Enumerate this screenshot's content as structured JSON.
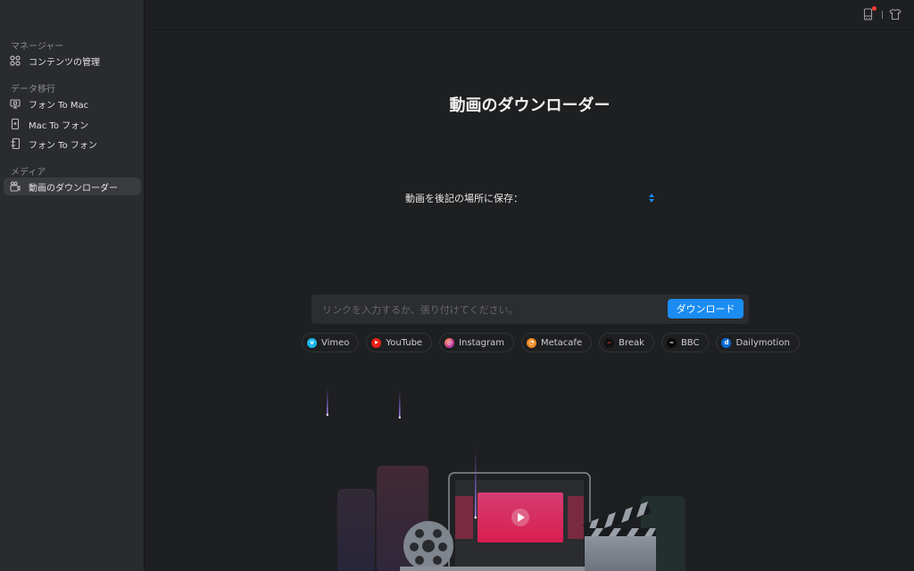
{
  "sidebar": {
    "sections": [
      {
        "label": "マネージャー",
        "items": [
          {
            "label": "コンテンツの管理",
            "icon": "grid-icon"
          }
        ]
      },
      {
        "label": "データ移行",
        "items": [
          {
            "label": "フォン To Mac",
            "icon": "monitor-icon"
          },
          {
            "label": "Mac To フォン",
            "icon": "phone-icon"
          },
          {
            "label": "フォン To フォン",
            "icon": "phone-transfer-icon"
          }
        ]
      },
      {
        "label": "メディア",
        "items": [
          {
            "label": "動画のダウンローダー",
            "icon": "video-download-icon",
            "active": true
          }
        ]
      }
    ]
  },
  "topbar": {
    "icons": [
      "device-icon",
      "tshirt-icon"
    ],
    "notification_color": "#ff3b30"
  },
  "main": {
    "title": "動画のダウンローダー",
    "save_label": "動画を後記の場所に保存：",
    "url_placeholder": "リンクを入力するか、張り付けてください。",
    "url_value": "",
    "download_label": "ダウンロード",
    "accent_color": "#1a8cf2",
    "sites": [
      {
        "name": "Vimeo",
        "color": "#1ab7ea",
        "glyph": "v"
      },
      {
        "name": "YouTube",
        "color": "#e62117",
        "glyph": "▶"
      },
      {
        "name": "Instagram",
        "color": "#d6408f",
        "glyph": "◎"
      },
      {
        "name": "Metacafe",
        "color": "#f08a24",
        "glyph": "◔"
      },
      {
        "name": "Break",
        "color": "#111111",
        "glyph": "━"
      },
      {
        "name": "BBC",
        "color": "#0a0a0a",
        "glyph": "━"
      },
      {
        "name": "Dailymotion",
        "color": "#0d6ad8",
        "glyph": "d"
      }
    ]
  }
}
